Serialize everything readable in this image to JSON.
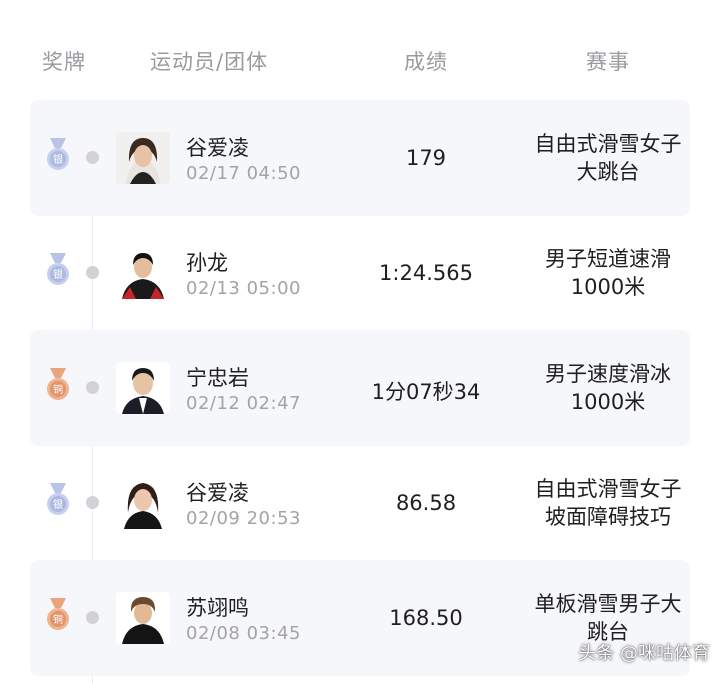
{
  "header": {
    "medal": "奖牌",
    "athlete": "运动员/团体",
    "score": "成绩",
    "event": "赛事"
  },
  "colors": {
    "silver": "#b8c3e6",
    "bronze": "#e9a47d",
    "row_shade": "#f6f7fa"
  },
  "rows": [
    {
      "medal": "silver",
      "medal_text": "银",
      "name": "谷爱凌",
      "date": "02/17 04:50",
      "score": "179",
      "event_line1": "自由式滑雪女子",
      "event_line2": "大跳台"
    },
    {
      "medal": "silver",
      "medal_text": "银",
      "name": "孙龙",
      "date": "02/13 05:00",
      "score": "1:24.565",
      "event_line1": "男子短道速滑",
      "event_line2": "1000米"
    },
    {
      "medal": "bronze",
      "medal_text": "铜",
      "name": "宁忠岩",
      "date": "02/12 02:47",
      "score": "1分07秒34",
      "event_line1": "男子速度滑冰",
      "event_line2": "1000米"
    },
    {
      "medal": "silver",
      "medal_text": "银",
      "name": "谷爱凌",
      "date": "02/09 20:53",
      "score": "86.58",
      "event_line1": "自由式滑雪女子",
      "event_line2": "坡面障碍技巧"
    },
    {
      "medal": "bronze",
      "medal_text": "铜",
      "name": "苏翊鸣",
      "date": "02/08 03:45",
      "score": "168.50",
      "event_line1": "单板滑雪男子大",
      "event_line2": "跳台"
    }
  ],
  "watermark": "头条 @咪咕体育"
}
